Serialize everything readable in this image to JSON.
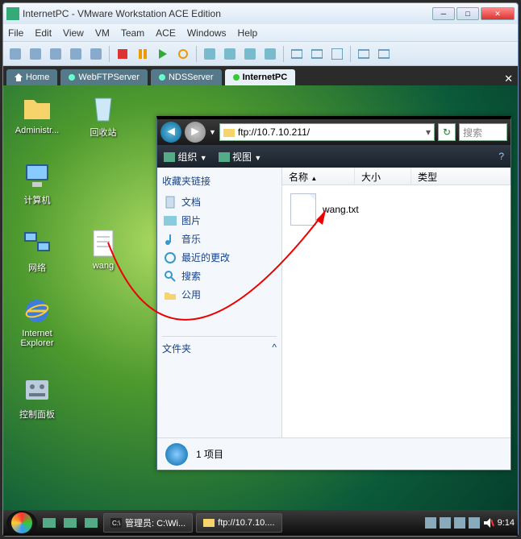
{
  "vm": {
    "title": "InternetPC - VMware Workstation ACE Edition",
    "menu": [
      "File",
      "Edit",
      "View",
      "VM",
      "Team",
      "ACE",
      "Windows",
      "Help"
    ]
  },
  "tabs": {
    "items": [
      {
        "label": "Home",
        "active": false
      },
      {
        "label": "WebFTPServer",
        "active": false
      },
      {
        "label": "NDSServer",
        "active": false
      },
      {
        "label": "InternetPC",
        "active": true
      }
    ]
  },
  "desktop": {
    "icons": {
      "admin": "Administr...",
      "recycle": "回收站",
      "computer": "计算机",
      "network": "网络",
      "wang": "wang",
      "ie1": "Internet",
      "ie2": "Explorer",
      "cpl": "控制面板"
    }
  },
  "explorer": {
    "address": "ftp://10.7.10.211/",
    "search_placeholder": "搜索",
    "cmd_organize": "组织",
    "cmd_view": "视图",
    "side_header": "收藏夹链接",
    "favs": [
      "文档",
      "图片",
      "音乐",
      "最近的更改",
      "搜索",
      "公用"
    ],
    "folders_label": "文件夹",
    "cols": {
      "name": "名称",
      "size": "大小",
      "type": "类型"
    },
    "file": "wang.txt",
    "status": "1 项目"
  },
  "taskbar": {
    "btn1": "管理员: C:\\Wi...",
    "btn2": "ftp://10.7.10....",
    "clock": "9:14"
  }
}
